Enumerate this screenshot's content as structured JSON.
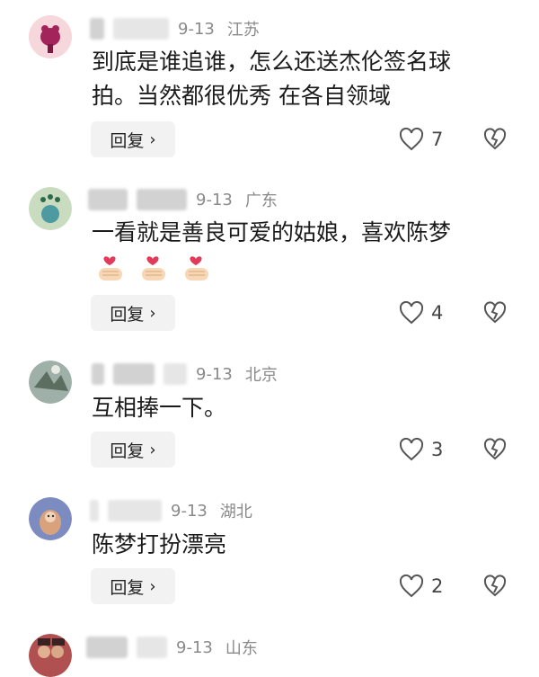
{
  "comments": [
    {
      "date": "9-13",
      "location": "江苏",
      "lines": [
        "到底是谁追谁，怎么还送杰伦签名球",
        "拍。当然都很优秀 在各自领域"
      ],
      "reply_label": "回复",
      "likes": "7"
    },
    {
      "date": "9-13",
      "location": "广东",
      "lines": [
        "一看就是善良可爱的姑娘，喜欢陈梦"
      ],
      "reply_label": "回复",
      "likes": "4"
    },
    {
      "date": "9-13",
      "location": "北京",
      "lines": [
        "互相捧一下。"
      ],
      "reply_label": "回复",
      "likes": "3"
    },
    {
      "date": "9-13",
      "location": "湖北",
      "lines": [
        "陈梦打扮漂亮"
      ],
      "reply_label": "回复",
      "likes": "2"
    },
    {
      "date": "9-13",
      "location": "山东"
    }
  ],
  "icons": {
    "reply_chevron": "›",
    "like": "heart-outline-icon",
    "dislike": "broken-heart-icon",
    "emoji": "finger-heart-emoji"
  }
}
